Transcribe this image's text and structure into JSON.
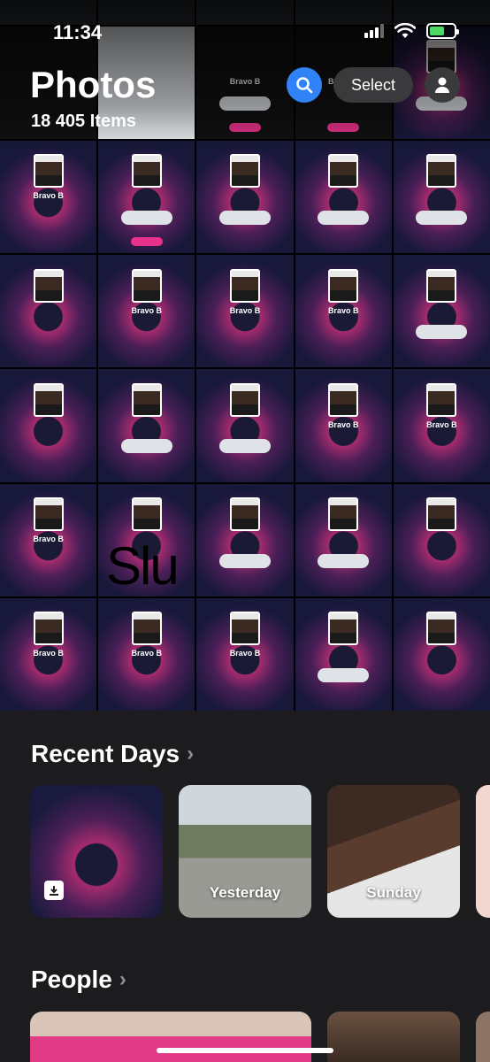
{
  "status": {
    "time": "11:34",
    "battery_level": 0.6
  },
  "header": {
    "title": "Photos",
    "item_count": "18 405 Items",
    "select_label": "Select",
    "search_icon": "search-icon",
    "profile_icon": "person-icon"
  },
  "grid": {
    "overlay_text": "Slu",
    "tile_name": "Bravo B"
  },
  "recent_days": {
    "title": "Recent Days",
    "cards": [
      {
        "label": ""
      },
      {
        "label": "Yesterday"
      },
      {
        "label": "Sunday"
      }
    ]
  },
  "people": {
    "title": "People"
  },
  "colors": {
    "accent": "#2f83f7",
    "background": "#1c1c1e",
    "vote_pink": "#e8318a"
  }
}
